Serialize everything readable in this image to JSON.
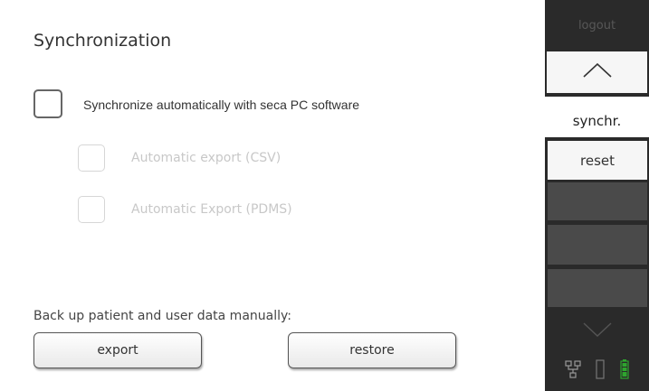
{
  "page": {
    "title": "Synchronization",
    "sync_checkbox_label": "Synchronize automatically with seca PC software",
    "csv_label": "Automatic export (CSV)",
    "pdms_label": "Automatic Export (PDMS)",
    "backup_label": "Back up patient and user data manually:",
    "export_label": "export",
    "restore_label": "restore"
  },
  "sidebar": {
    "logout_label": "logout",
    "active_label": "synchr.",
    "reset_label": "reset",
    "up_icon": "chevron-up-icon",
    "down_icon": "chevron-down-icon",
    "status_icons": [
      "network-icon",
      "tube-icon",
      "battery-icon"
    ]
  },
  "colors": {
    "sidebar_dark": "#2a2a2a",
    "sidebar_button_grey": "#4a4a4a",
    "disabled_text": "#c8c8c8",
    "battery_green": "#2ea52e"
  }
}
